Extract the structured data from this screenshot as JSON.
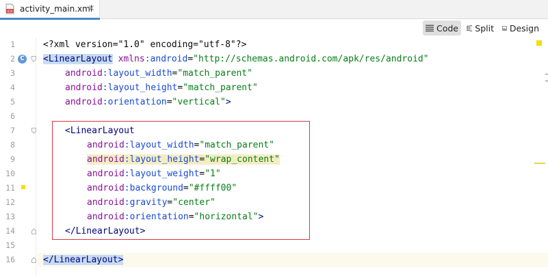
{
  "tab": {
    "filename": "activity_main.xml",
    "close_glyph": "×",
    "icon": "xml-file-icon"
  },
  "toolbar": {
    "code_label": "Code",
    "split_label": "Split",
    "design_label": "Design",
    "active": "Code"
  },
  "gutter": {
    "line_numbers": [
      "1",
      "2",
      "3",
      "4",
      "5",
      "6",
      "7",
      "8",
      "9",
      "10",
      "11",
      "12",
      "13",
      "14",
      "15",
      "16"
    ],
    "class_badge": "C"
  },
  "colors": {
    "tag": "#000080",
    "attribute": "#174ad4",
    "namespace": "#871094",
    "value": "#067d17",
    "selection_box": "#d9363e",
    "warning_marker": "#f2e100"
  },
  "code": {
    "l1_decl": "<?xml version=\"1.0\" encoding=\"utf-8\"?>",
    "l2_open": "<LinearLayout",
    "l2_ns_kw": "xmlns",
    "l2_ns_attr": ":android",
    "l2_eq": "=",
    "l2_val": "\"http://schemas.android.com/apk/res/android\"",
    "l3_ns": "android",
    "l3_attr": ":layout_width",
    "l3_val": "\"match_parent\"",
    "l4_ns": "android",
    "l4_attr": ":layout_height",
    "l4_val": "\"match_parent\"",
    "l5_ns": "android",
    "l5_attr": ":orientation",
    "l5_val": "\"vertical\"",
    "l5_end": ">",
    "l7_open": "<LinearLayout",
    "l8_ns": "android",
    "l8_attr": ":layout_width",
    "l8_val": "\"match_parent\"",
    "l9_ns": "android",
    "l9_attr": ":layout_height",
    "l9_val": "\"wrap_content\"",
    "l10_ns": "android",
    "l10_attr": ":layout_weight",
    "l10_val": "\"1\"",
    "l11_ns": "android",
    "l11_attr": ":background",
    "l11_val": "\"#ffff00\"",
    "l12_ns": "android",
    "l12_attr": ":gravity",
    "l12_val": "\"center\"",
    "l13_ns": "android",
    "l13_attr": ":orientation",
    "l13_val": "\"horizontal\"",
    "l13_end": ">",
    "l14_close": "</LinearLayout>",
    "l16_close": "</LinearLayout>"
  }
}
